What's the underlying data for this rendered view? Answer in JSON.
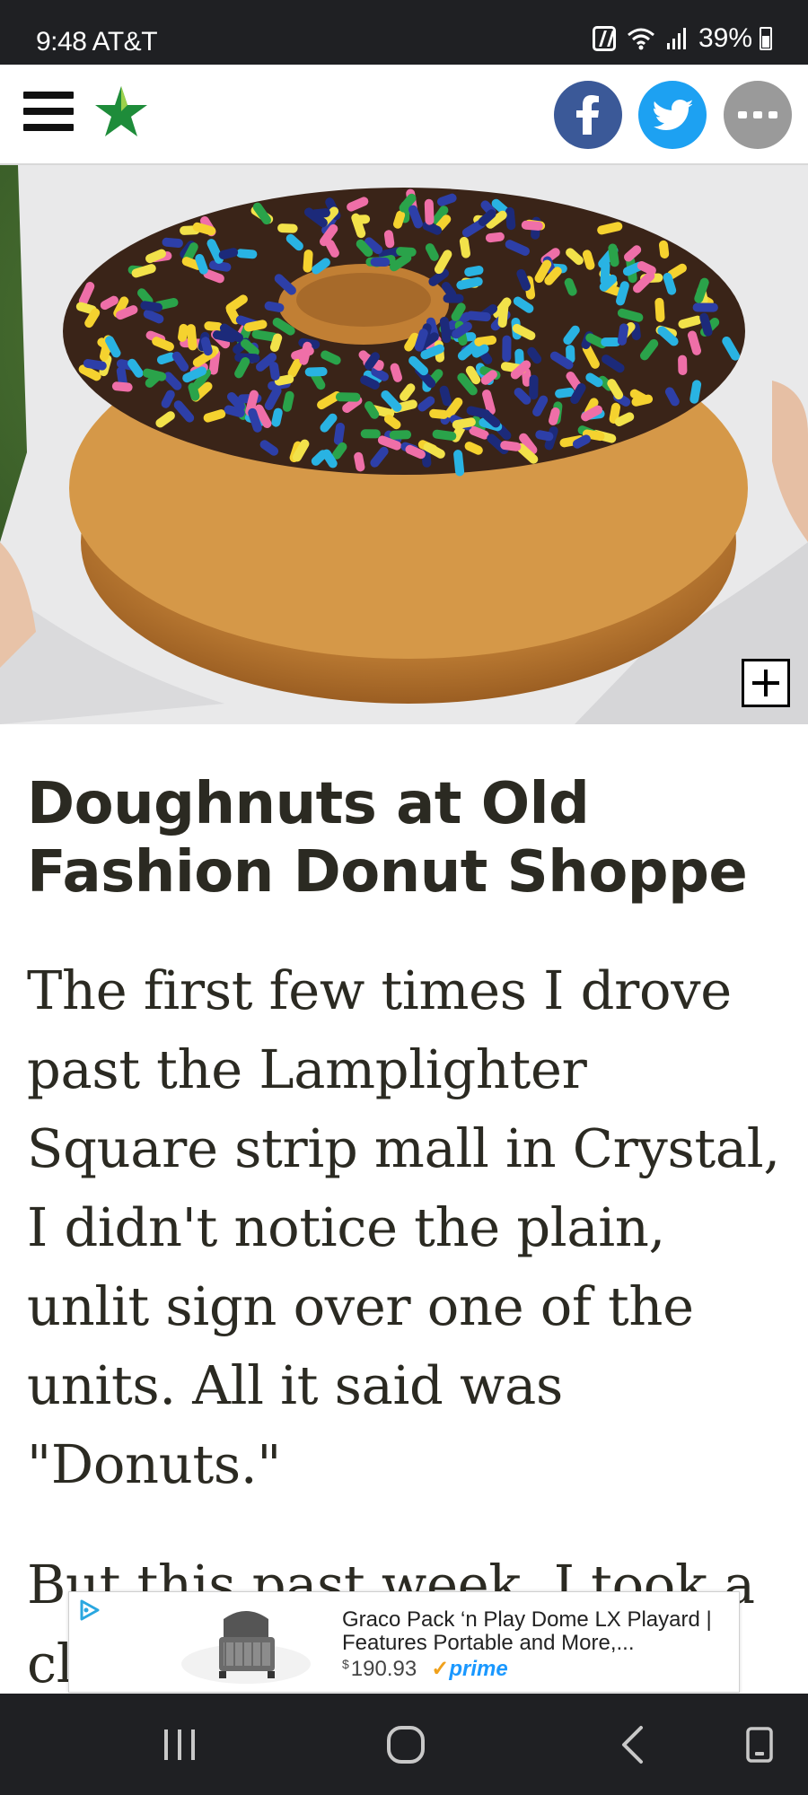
{
  "status_bar": {
    "time": "9:48",
    "carrier": "AT&T",
    "battery": "39%",
    "icons": [
      "nfc-icon",
      "wifi-icon",
      "signal-icon",
      "battery-icon"
    ]
  },
  "header": {
    "menu_icon": "hamburger-menu-icon",
    "logo_icon": "star-logo-icon",
    "share_buttons": [
      {
        "name": "facebook",
        "color": "#3b5998"
      },
      {
        "name": "twitter",
        "color": "#1da1f2"
      },
      {
        "name": "more",
        "color": "#9a9a9a"
      }
    ]
  },
  "hero": {
    "expand_icon": "plus-icon"
  },
  "article": {
    "headline": "Doughnuts at Old Fashion Donut Shoppe",
    "paragraph_1": "The first few times I drove past the Lamplighter Square strip mall in Crystal, I didn't notice the plain, unlit sign over one of the units. All it said was \"Donuts.\"",
    "paragraph_2": "But this past week, I took a closer look"
  },
  "ad": {
    "title": "Graco Pack ‘n Play Dome LX Playard | Features Portable and More,...",
    "currency": "$",
    "price": "190.93",
    "prime_check": "✓",
    "prime_label": "prime"
  },
  "nav_bar": {
    "buttons": [
      "recents-icon",
      "home-icon",
      "back-icon",
      "rotate-icon"
    ]
  },
  "colors": {
    "status_bar_bg": "#1f2023",
    "headline_text": "#2b2a22",
    "logo_star": "#1e8c3a",
    "prime_blue": "#1a98ff",
    "prime_check": "#f0a11b"
  }
}
